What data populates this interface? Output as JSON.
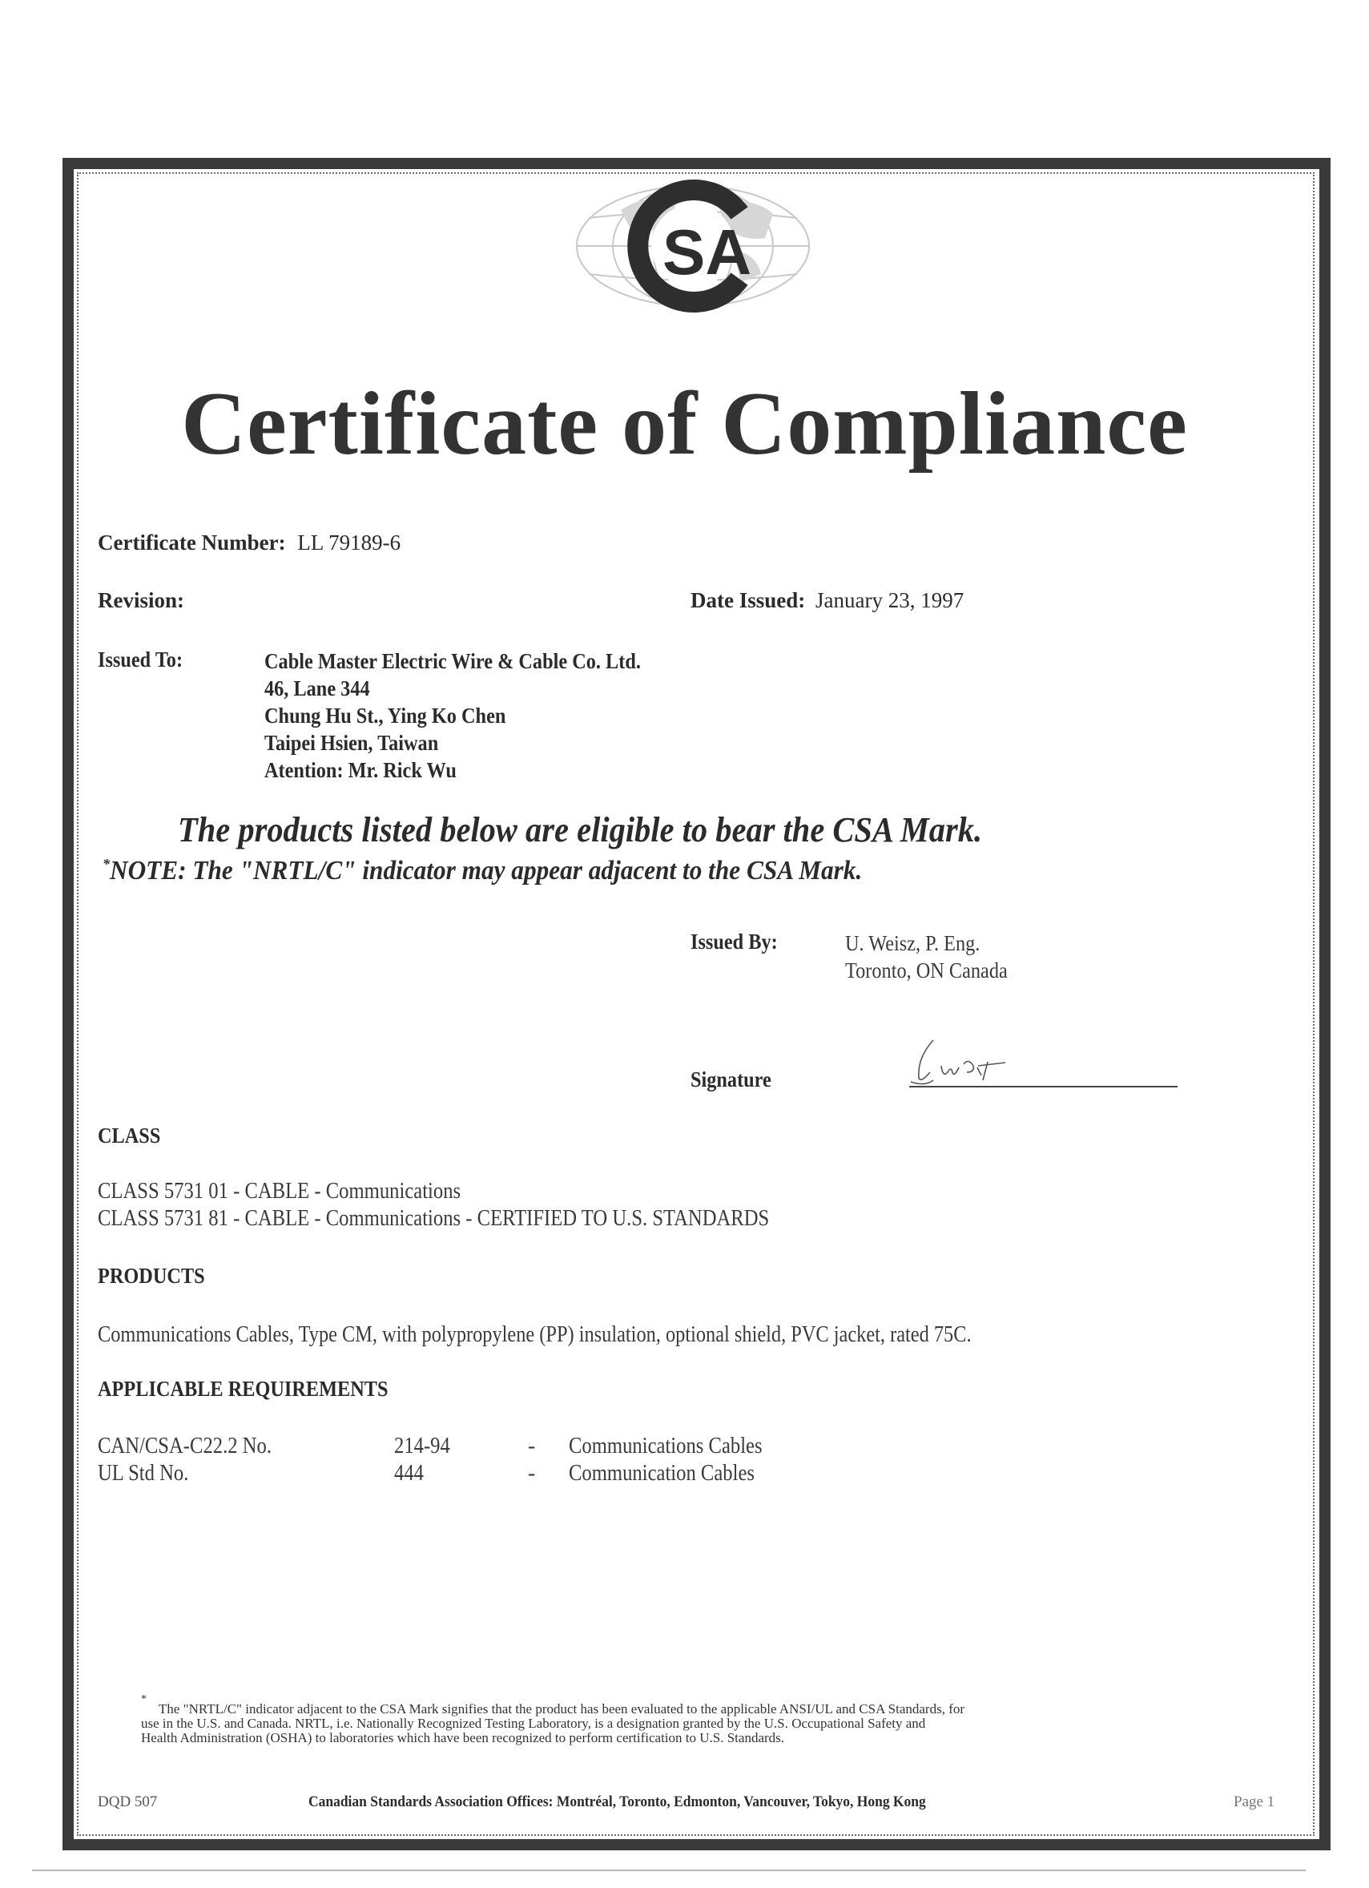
{
  "document": {
    "title": "Certificate of Compliance",
    "logo": {
      "name": "CSA",
      "icon": "csa-globe-logo",
      "letters": "SA"
    },
    "certificate_number_label": "Certificate Number:",
    "certificate_number": "LL 79189-6",
    "revision_label": "Revision:",
    "revision": "",
    "date_issued_label": "Date Issued:",
    "date_issued": "January 23, 1997",
    "issued_to_label": "Issued To:",
    "issued_to": [
      "Cable Master Electric Wire & Cable Co. Ltd.",
      "46, Lane 344",
      "Chung Hu St., Ying Ko Chen",
      "Taipei Hsien, Taiwan",
      "Atention: Mr. Rick Wu"
    ],
    "eligibility_statement": "The products listed below are eligible to bear the CSA Mark.",
    "note_asterisk": "*",
    "note": "NOTE:  The \"NRTL/C\" indicator may appear adjacent to the CSA Mark.",
    "issued_by_label": "Issued By:",
    "issued_by": [
      "U. Weisz, P. Eng.",
      "Toronto, ON  Canada"
    ],
    "signature_label": "Signature",
    "signature_scrawl": "liist",
    "class": {
      "heading": "CLASS",
      "items": [
        "CLASS 5731 01 - CABLE - Communications",
        "CLASS 5731 81 - CABLE - Communications - CERTIFIED TO U.S. STANDARDS"
      ]
    },
    "products": {
      "heading": "PRODUCTS",
      "description": "Communications Cables, Type CM, with polypropylene (PP) insulation, optional shield, PVC jacket,  rated 75C."
    },
    "requirements": {
      "heading": "APPLICABLE REQUIREMENTS",
      "rows": [
        {
          "standard": "CAN/CSA-C22.2 No.",
          "number": "214-94",
          "dash": "-",
          "title": "Communications Cables"
        },
        {
          "standard": "UL Std No.",
          "number": "444",
          "dash": "-",
          "title": "Communication Cables"
        }
      ]
    },
    "footnote": {
      "asterisk": "*",
      "lines": [
        "The \"NRTL/C\" indicator adjacent to the CSA Mark signifies that the product has been evaluated to the applicable ANSI/UL and CSA Standards, for",
        "use in the U.S. and Canada.  NRTL, i.e. Nationally Recognized Testing Laboratory, is a designation granted by the U.S. Occupational Safety and",
        "Health Administration (OSHA) to laboratories which have been recognized to perform certification to U.S. Standards."
      ]
    },
    "footer": {
      "form_code": "DQD 507",
      "offices": "Canadian Standards Association Offices:  Montréal, Toronto, Edmonton, Vancouver, Tokyo, Hong Kong",
      "page": "Page 1"
    }
  }
}
